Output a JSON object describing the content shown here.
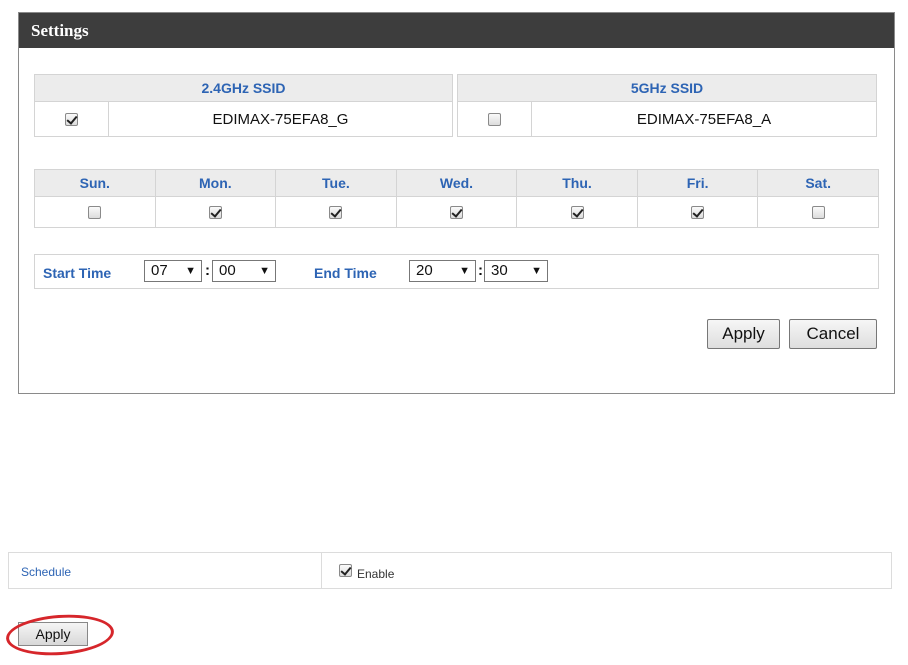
{
  "panel": {
    "title": "Settings",
    "ssid_24": {
      "header": "2.4GHz SSID",
      "checked": true,
      "name": "EDIMAX-75EFA8_G"
    },
    "ssid_5": {
      "header": "5GHz SSID",
      "checked": false,
      "name": "EDIMAX-75EFA8_A"
    },
    "days": [
      {
        "label": "Sun.",
        "checked": false
      },
      {
        "label": "Mon.",
        "checked": true
      },
      {
        "label": "Tue.",
        "checked": true
      },
      {
        "label": "Wed.",
        "checked": true
      },
      {
        "label": "Thu.",
        "checked": true
      },
      {
        "label": "Fri.",
        "checked": true
      },
      {
        "label": "Sat.",
        "checked": false
      }
    ],
    "start_time": {
      "label": "Start Time",
      "hour": "07",
      "minute": "00"
    },
    "end_time": {
      "label": "End Time",
      "hour": "20",
      "minute": "30"
    },
    "time_separator": ":",
    "dropdown_arrow": "▼",
    "apply_label": "Apply",
    "cancel_label": "Cancel"
  },
  "schedule": {
    "label": "Schedule",
    "enabled": true,
    "enable_label": "Enable",
    "apply_label": "Apply",
    "highlight_color": "#d6262b"
  }
}
